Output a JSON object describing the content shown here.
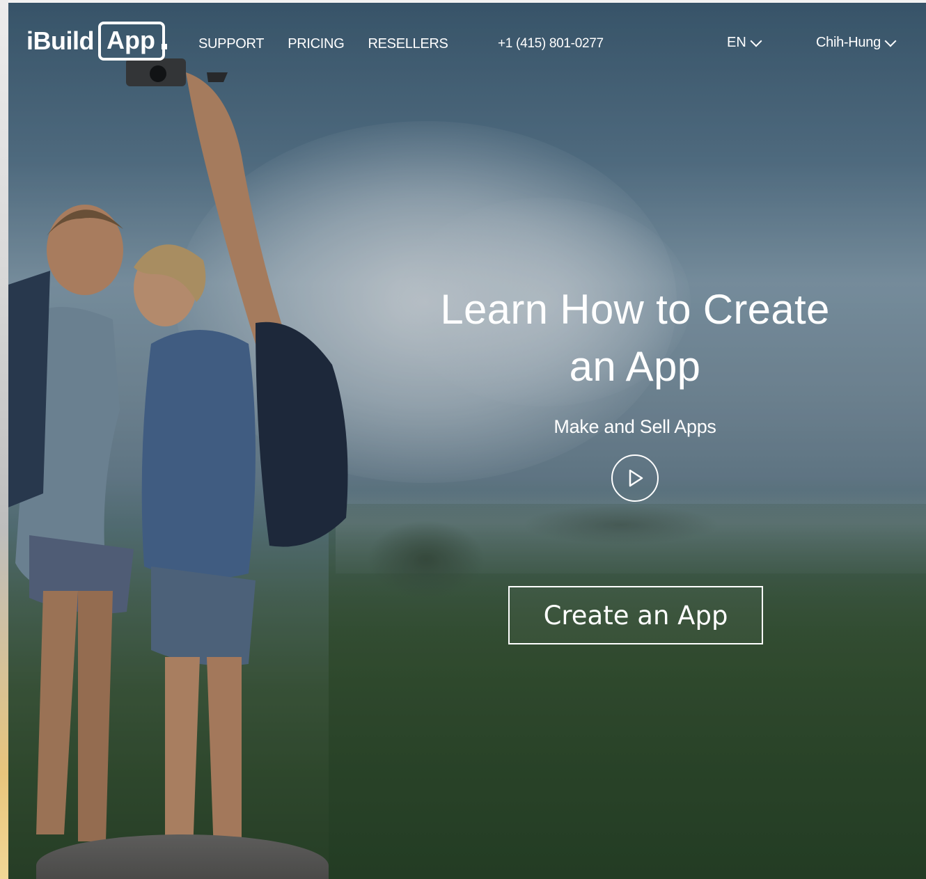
{
  "brand": {
    "logo_text_1": "iBuild",
    "logo_text_2": "App"
  },
  "nav": {
    "items": [
      {
        "label": "SUPPORT"
      },
      {
        "label": "PRICING"
      },
      {
        "label": "RESELLERS"
      }
    ],
    "phone": "+1 (415) 801-0277",
    "language": "EN",
    "user": "Chih-Hung"
  },
  "hero": {
    "headline_line1": "Learn How to Create",
    "headline_line2": "an App",
    "subheadline": "Make and Sell Apps",
    "cta_label": "Create an App",
    "play_icon": "play-circle-icon"
  },
  "colors": {
    "text": "#ffffff",
    "sky": "#5b7a90",
    "land": "#34502d"
  }
}
